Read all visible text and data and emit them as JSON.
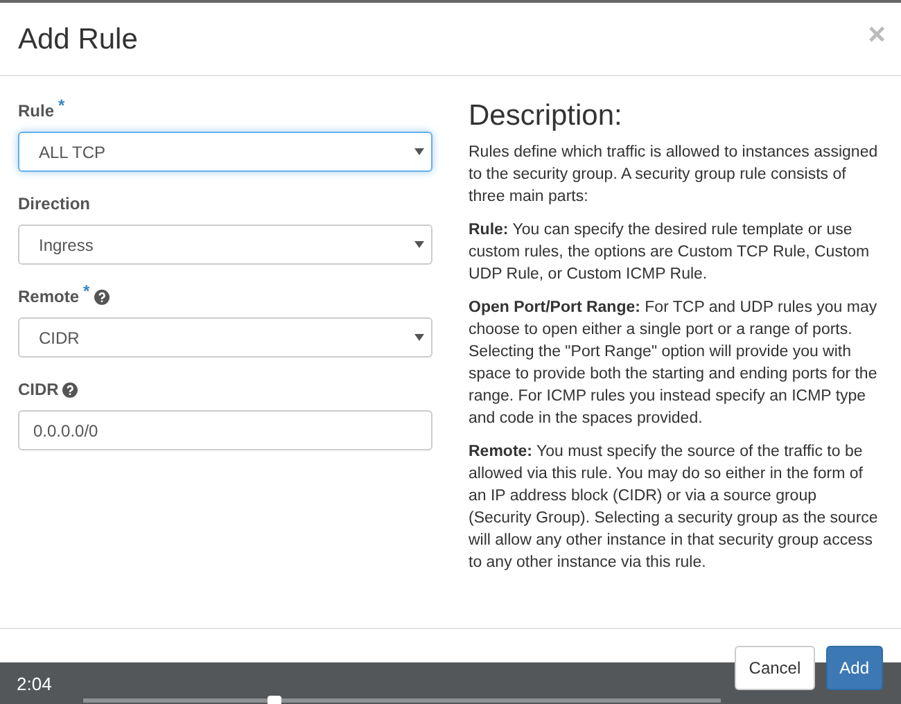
{
  "modal": {
    "title": "Add Rule",
    "close": "×"
  },
  "fields": [
    {
      "kind": "select",
      "label": "Rule",
      "required_mark": "*",
      "help": false,
      "value": "ALL TCP",
      "focused": true
    },
    {
      "kind": "select",
      "label": "Direction",
      "help": false,
      "value": "Ingress",
      "focused": false
    },
    {
      "kind": "select",
      "label": "Remote",
      "required_mark": "*",
      "help": true,
      "value": "CIDR",
      "focused": false
    },
    {
      "kind": "input",
      "label": "CIDR",
      "help": true,
      "value": "0.0.0.0/0",
      "focused": false
    }
  ],
  "description": {
    "heading": "Description:",
    "paragraphs": [
      "Rules define which traffic is allowed to instances assigned to the security group. A security group rule consists of three main parts:",
      "**Rule:** You can specify the desired rule template or use custom rules, the options are Custom TCP Rule, Custom UDP Rule, or Custom ICMP Rule.",
      "**Open Port/Port Range:** For TCP and UDP rules you may choose to open either a single port or a range of ports. Selecting the \"Port Range\" option will provide you with space to provide both the starting and ending ports for the range. For ICMP rules you instead specify an ICMP type and code in the spaces provided.",
      "**Remote:** You must specify the source of the traffic to be allowed via this rule. You may do so either in the form of an IP address block (CIDR) or via a source group (Security Group). Selecting a security group as the source will allow any other instance in that security group access to any other instance via this rule."
    ]
  },
  "buttons": [
    {
      "label": "Cancel",
      "kind": "default"
    },
    {
      "label": "Add",
      "kind": "primary"
    }
  ],
  "player": {
    "time": "2:04",
    "level": 0.3
  }
}
